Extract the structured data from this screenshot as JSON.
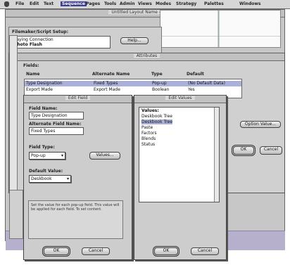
{
  "menubar": {
    "items": [
      "File",
      "Edit",
      "Text",
      "Sequence",
      "Pages",
      "Tools",
      "Admin",
      "Views",
      "Modes",
      "Strategy",
      "Palettes",
      "Windows"
    ],
    "active_index": 3
  },
  "layout_window": {
    "title": "Untitled Layout Name - Untitled"
  },
  "palette": {
    "label": "Filemaker/Script Setup:",
    "items": [
      "Paying Connection",
      "Photo Flash"
    ],
    "button": "Help..."
  },
  "attributes_dialog": {
    "title": "Attributes",
    "section_label": "Fields:",
    "columns": [
      "Name",
      "Alternate Name",
      "Type",
      "Default"
    ],
    "rows": [
      {
        "name": "Type Designation",
        "alt": "Fixed Types",
        "type": "Pop-up",
        "default": "(No Default Data)"
      },
      {
        "name": "Export Made",
        "alt": "Export Made",
        "type": "Boolean",
        "default": "Yes"
      }
    ],
    "side_button": "Option Value...",
    "ok": "OK",
    "cancel": "Cancel"
  },
  "edit_field_dialog": {
    "title": "Edit Field",
    "field_name_label": "Field Name:",
    "field_name_value": "Type Designation",
    "alt_name_label": "Alternate Field Name:",
    "alt_name_value": "Fixed Types",
    "field_type_label": "Field Type:",
    "field_type_value": "Pop-up",
    "values_button": "Values...",
    "default_label": "Default Value:",
    "default_value": "Deskbook",
    "instructions": "Set the value for each pop-up field. This value will be applied for each field. To set content.",
    "ok": "OK",
    "cancel": "Cancel"
  },
  "edit_values_dialog": {
    "title": "Edit Values",
    "list_label": "Values:",
    "values": [
      "Deskbook Tree",
      "Deskbook Tree",
      "Paste",
      "Factors",
      "Blends",
      "Status"
    ],
    "selected_index": 1,
    "ok": "OK",
    "cancel": "Cancel"
  }
}
